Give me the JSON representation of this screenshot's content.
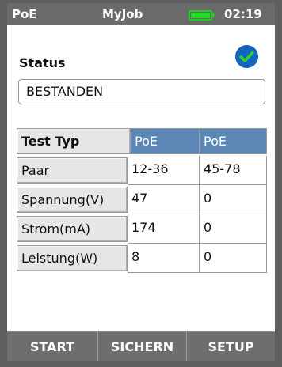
{
  "topbar": {
    "mode": "PoE",
    "job": "MyJob",
    "clock": "02:19",
    "battery_icon": "battery-full-icon",
    "battery_color": "#22dd22"
  },
  "status": {
    "label": "Status",
    "value": "BESTANDEN",
    "icon": "check-circle-icon",
    "icon_color": "#1565c0"
  },
  "table": {
    "header": [
      "Test Typ",
      "PoE",
      "PoE"
    ],
    "rows": [
      {
        "label": "Paar",
        "a": "12-36",
        "b": "45-78"
      },
      {
        "label": "Spannung(V)",
        "a": "47",
        "b": "0"
      },
      {
        "label": "Strom(mA)",
        "a": "174",
        "b": "0"
      },
      {
        "label": "Leistung(W)",
        "a": "8",
        "b": "0"
      }
    ],
    "header_color": "#5b86b6"
  },
  "buttons": {
    "start": "START",
    "save": "SICHERN",
    "setup": "SETUP"
  }
}
